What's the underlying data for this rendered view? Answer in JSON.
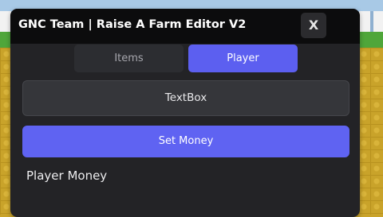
{
  "window": {
    "title": "GNC Team | Raise A Farm Editor V2",
    "close_label": "X"
  },
  "tabs": [
    {
      "label": "Items",
      "active": false
    },
    {
      "label": "Player",
      "active": true
    }
  ],
  "player": {
    "textbox_text": "TextBox",
    "set_money_label": "Set Money",
    "money_label": "Player Money"
  },
  "colors": {
    "accent": "#5c5ff0",
    "window_bg": "#232326",
    "titlebar_bg": "#0c0c0d"
  }
}
